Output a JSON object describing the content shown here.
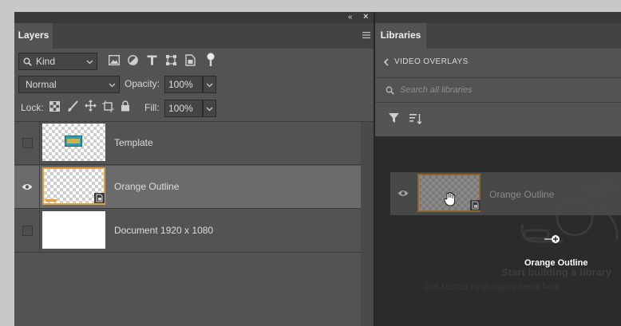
{
  "layers_panel": {
    "tab_label": "Layers",
    "filter": {
      "kind_label": "Kind"
    },
    "blend_mode": "Normal",
    "opacity": {
      "label": "Opacity:",
      "value": "100%"
    },
    "lock": {
      "label": "Lock:"
    },
    "fill": {
      "label": "Fill:",
      "value": "100%"
    },
    "layers": [
      {
        "name": "Template",
        "visible": false,
        "selected": false
      },
      {
        "name": "Orange Outline",
        "visible": true,
        "selected": true
      },
      {
        "name": "Document 1920 x 1080",
        "visible": false,
        "selected": false
      }
    ]
  },
  "libraries_panel": {
    "tab_label": "Libraries",
    "breadcrumb": "VIDEO OVERLAYS",
    "search_placeholder": "Search all libraries",
    "drag_item_name": "Orange Outline",
    "drag_tooltip": "Orange Outline",
    "empty_state_title": "Start building a library",
    "empty_state_text": "Get started by dragging items here"
  },
  "colors": {
    "panel_bg": "#535353",
    "tab_bar": "#424242",
    "selected_row": "#6b6b6b",
    "orange_accent": "#e8a13a",
    "libraries_dark": "#2b2b2b"
  }
}
